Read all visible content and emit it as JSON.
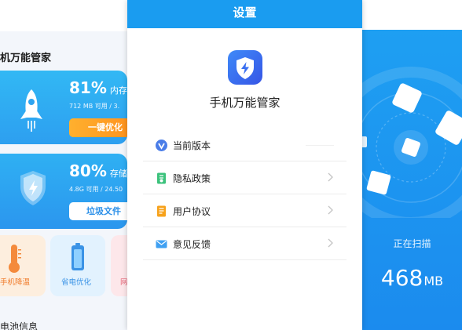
{
  "left": {
    "title": "机万能管家",
    "memory": {
      "percent": "81%",
      "percent_label": "内存",
      "detail": "712 MB 可用 / 3.",
      "button": "一键优化"
    },
    "storage": {
      "percent": "80%",
      "percent_label": "存储容",
      "detail": "4.8G 可用 / 24.50",
      "button": "垃圾文件"
    },
    "tiles": [
      {
        "label": "手机降温"
      },
      {
        "label": "省电优化"
      },
      {
        "label": "网"
      }
    ],
    "battery_info": "电池信息"
  },
  "settings": {
    "header": "设置",
    "app_name": "手机万能管家",
    "menu": [
      {
        "label": "当前版本",
        "icon": "version-icon"
      },
      {
        "label": "隐私政策",
        "icon": "privacy-icon"
      },
      {
        "label": "用户协议",
        "icon": "agreement-icon"
      },
      {
        "label": "意见反馈",
        "icon": "feedback-icon"
      }
    ]
  },
  "scan": {
    "label": "正在扫描",
    "value": "468",
    "unit": "MB"
  },
  "colors": {
    "primary_blue": "#1a9cf0",
    "orange": "#ff9a24"
  }
}
